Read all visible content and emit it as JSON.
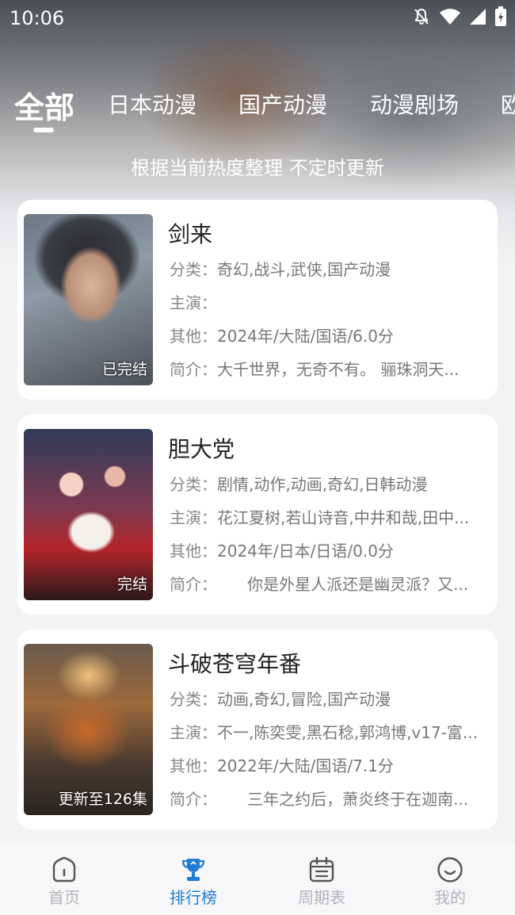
{
  "status_bar": {
    "time": "10:06"
  },
  "tabs": [
    {
      "label": "全部",
      "active": true
    },
    {
      "label": "日本动漫"
    },
    {
      "label": "国产动漫"
    },
    {
      "label": "动漫剧场"
    },
    {
      "label": "欧"
    }
  ],
  "subtitle": "根据当前热度整理 不定时更新",
  "labels": {
    "category": "分类：",
    "cast": "主演：",
    "other": "其他：",
    "intro": "简介："
  },
  "cards": [
    {
      "title": "剑来",
      "badge": "已完结",
      "category": "奇幻,战斗,武侠,国产动漫",
      "cast": "",
      "other": "2024年/大陆/国语/6.0分",
      "intro": "大千世界，无奇不有。 骊珠洞天..."
    },
    {
      "title": "胆大党",
      "badge": "完结",
      "category": "剧情,动作,动画,奇幻,日韩动漫",
      "cast": "花江夏树,若山诗音,中井和哉,田中...",
      "other": "2024年/日本/日语/0.0分",
      "intro": "      你是外星人派还是幽灵派？又..."
    },
    {
      "title": "斗破苍穹年番",
      "badge": "更新至126集",
      "category": "动画,奇幻,冒险,国产动漫",
      "cast": "不一,陈奕雯,黑石稔,郭鸿博,v17-富...",
      "other": "2022年/大陆/国语/7.1分",
      "intro": "      三年之约后，萧炎终于在迦南..."
    }
  ],
  "bottom_nav": [
    {
      "label": "首页",
      "icon": "home-icon"
    },
    {
      "label": "排行榜",
      "icon": "trophy-icon",
      "active": true
    },
    {
      "label": "周期表",
      "icon": "calendar-icon"
    },
    {
      "label": "我的",
      "icon": "smile-icon"
    }
  ],
  "colors": {
    "accent": "#1e7bd6",
    "nav_inactive": "#b4b4b8"
  }
}
